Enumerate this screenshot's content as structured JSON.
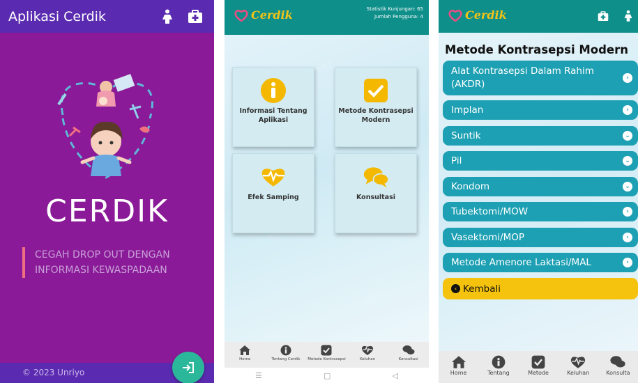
{
  "panel1": {
    "title": "Aplikasi Cerdik",
    "brand": "CERDIK",
    "tagline_line1": "CEGAH DROP OUT DENGAN",
    "tagline_line2": "INFORMASI KEWASPADAAN",
    "footer": "© 2023 Unriyo",
    "icons": [
      "woman-icon",
      "first-aid-icon",
      "login-icon"
    ],
    "colors": {
      "background": "#8a1a97",
      "bar": "#5a2bb0",
      "fab": "#2bb79a"
    }
  },
  "panel2": {
    "logo_text": "Cerdik",
    "stats_line1": "Statistik Kunjungan: 65",
    "stats_line2": "Jumlah Pengguna: 4",
    "cards": [
      {
        "label": "Informasi Tentang Aplikasi",
        "icon": "info-icon"
      },
      {
        "label": "Metode Kontrasepsi Modern",
        "icon": "checkbox-icon"
      },
      {
        "label": "Efek Samping",
        "icon": "heartbeat-icon"
      },
      {
        "label": "Konsultasi",
        "icon": "chat-icon"
      }
    ],
    "nav": [
      "Home",
      "Tentang Cerdik",
      "Metode Kontrasepsi",
      "Keluhan",
      "Konsultasi"
    ],
    "colors": {
      "header": "#0e8f8a",
      "card": "#d3ebf1",
      "accent": "#f3c418"
    }
  },
  "panel3": {
    "logo_text": "Cerdik",
    "heading": "Metode Kontrasepsi Modern",
    "items": [
      {
        "label_line1": "Alat Kontrasepsi Dalam Rahim",
        "label_line2": "(AKDR)",
        "arrow": "right"
      },
      {
        "label_line1": "Implan",
        "arrow": "right"
      },
      {
        "label_line1": "Suntik",
        "arrow": "down"
      },
      {
        "label_line1": "Pil",
        "arrow": "down"
      },
      {
        "label_line1": "Kondom",
        "arrow": "down"
      },
      {
        "label_line1": "Tubektomi/MOW",
        "arrow": "right"
      },
      {
        "label_line1": "Vasektomi/MOP",
        "arrow": "right"
      },
      {
        "label_line1": "Metode Amenore Laktasi/MAL",
        "arrow": "right"
      }
    ],
    "back_label": "Kembali",
    "nav": [
      "Home",
      "Tentang",
      "Metode",
      "Keluhan",
      "Konsulta"
    ],
    "colors": {
      "item": "#1da0b3",
      "back": "#f5c30e"
    }
  }
}
